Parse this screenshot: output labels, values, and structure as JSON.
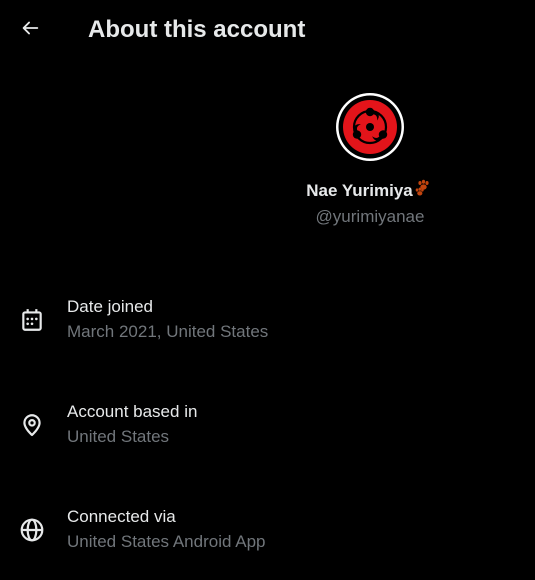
{
  "header": {
    "back_icon": "arrow-left-icon",
    "title": "About this account"
  },
  "profile": {
    "display_name": "Nae Yurimiya",
    "badge_icon": "paw-prints-emoji",
    "handle": "@yurimiyanae",
    "avatar_colors": {
      "ring": "#000000",
      "border": "#ffffff",
      "fill": "#e3141a"
    }
  },
  "details": [
    {
      "icon": "calendar-icon",
      "label": "Date joined",
      "value": "March 2021, United States"
    },
    {
      "icon": "location-pin-icon",
      "label": "Account based in",
      "value": "United States"
    },
    {
      "icon": "globe-icon",
      "label": "Connected via",
      "value": "United States Android App"
    }
  ],
  "colors": {
    "background": "#000000",
    "primary_text": "#e7e9ea",
    "secondary_text": "#71767b"
  }
}
